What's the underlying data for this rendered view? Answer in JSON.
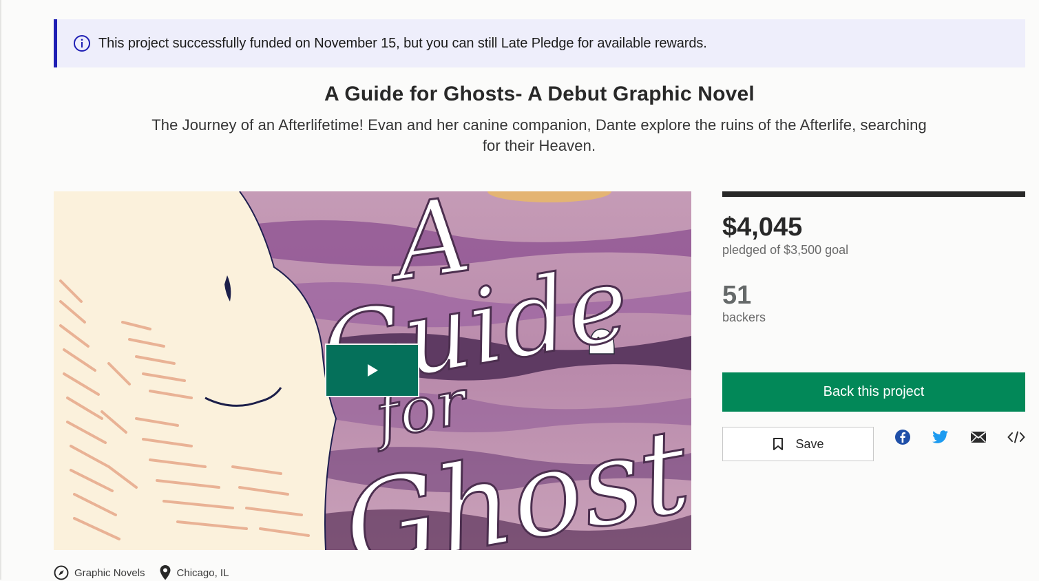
{
  "notice": {
    "text": "This project successfully funded on November 15, but you can still Late Pledge for available rewards.",
    "icon": "info-circle-icon",
    "accent": "#1e1eb4",
    "background": "#eeeefb"
  },
  "project": {
    "title": "A Guide for Ghosts- A Debut Graphic Novel",
    "subtitle": "The Journey of an Afterlifetime! Evan and her canine companion, Dante explore the ruins of the Afterlife, searching for their Heaven."
  },
  "video": {
    "cover_title": "A Guide for Ghosts",
    "play_icon": "play-icon"
  },
  "stats": {
    "pledged": "$4,045",
    "goal_text": "pledged of $3,500 goal",
    "backers": "51",
    "backers_label": "backers",
    "progress_fraction": 1.0
  },
  "actions": {
    "back_label": "Back this project",
    "save_label": "Save",
    "share_icons": [
      "facebook-icon",
      "twitter-icon",
      "email-icon",
      "embed-icon"
    ]
  },
  "meta": {
    "category": "Graphic Novels",
    "location": "Chicago, IL"
  },
  "colors": {
    "primary_green": "#028858",
    "play_green": "#05705a"
  }
}
